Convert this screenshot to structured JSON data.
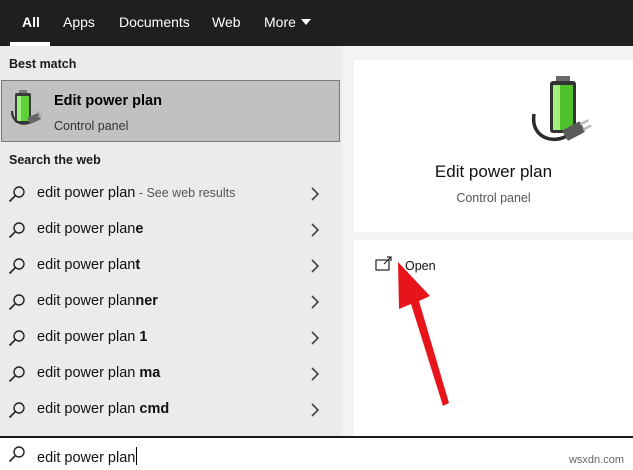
{
  "tabs": [
    {
      "label": "All",
      "active": true
    },
    {
      "label": "Apps"
    },
    {
      "label": "Documents"
    },
    {
      "label": "Web"
    },
    {
      "label": "More"
    }
  ],
  "best_match": {
    "header": "Best match",
    "title": "Edit power plan",
    "subtitle": "Control panel",
    "icon": "power-plan-battery-icon"
  },
  "web_search": {
    "header": "Search the web",
    "results": [
      {
        "prefix": "edit power plan",
        "bold": "",
        "hint": " - See web results"
      },
      {
        "prefix": "edit power plan",
        "bold": "e",
        "hint": ""
      },
      {
        "prefix": "edit power plan",
        "bold": "t",
        "hint": ""
      },
      {
        "prefix": "edit power plan",
        "bold": "ner",
        "hint": ""
      },
      {
        "prefix": "edit power plan ",
        "bold": "1",
        "hint": ""
      },
      {
        "prefix": "edit power plan ",
        "bold": "ma",
        "hint": ""
      },
      {
        "prefix": "edit power plan ",
        "bold": "cmd",
        "hint": ""
      }
    ]
  },
  "preview": {
    "title": "Edit power plan",
    "subtitle": "Control panel",
    "actions": [
      {
        "label": "Open",
        "icon": "open-external-icon"
      }
    ]
  },
  "search": {
    "value": "edit power plan"
  },
  "watermark": "wsxdn.com",
  "colors": {
    "topbar": "#1f1f1f",
    "selected": "#c1c1c1",
    "arrow": "#e8141c"
  }
}
